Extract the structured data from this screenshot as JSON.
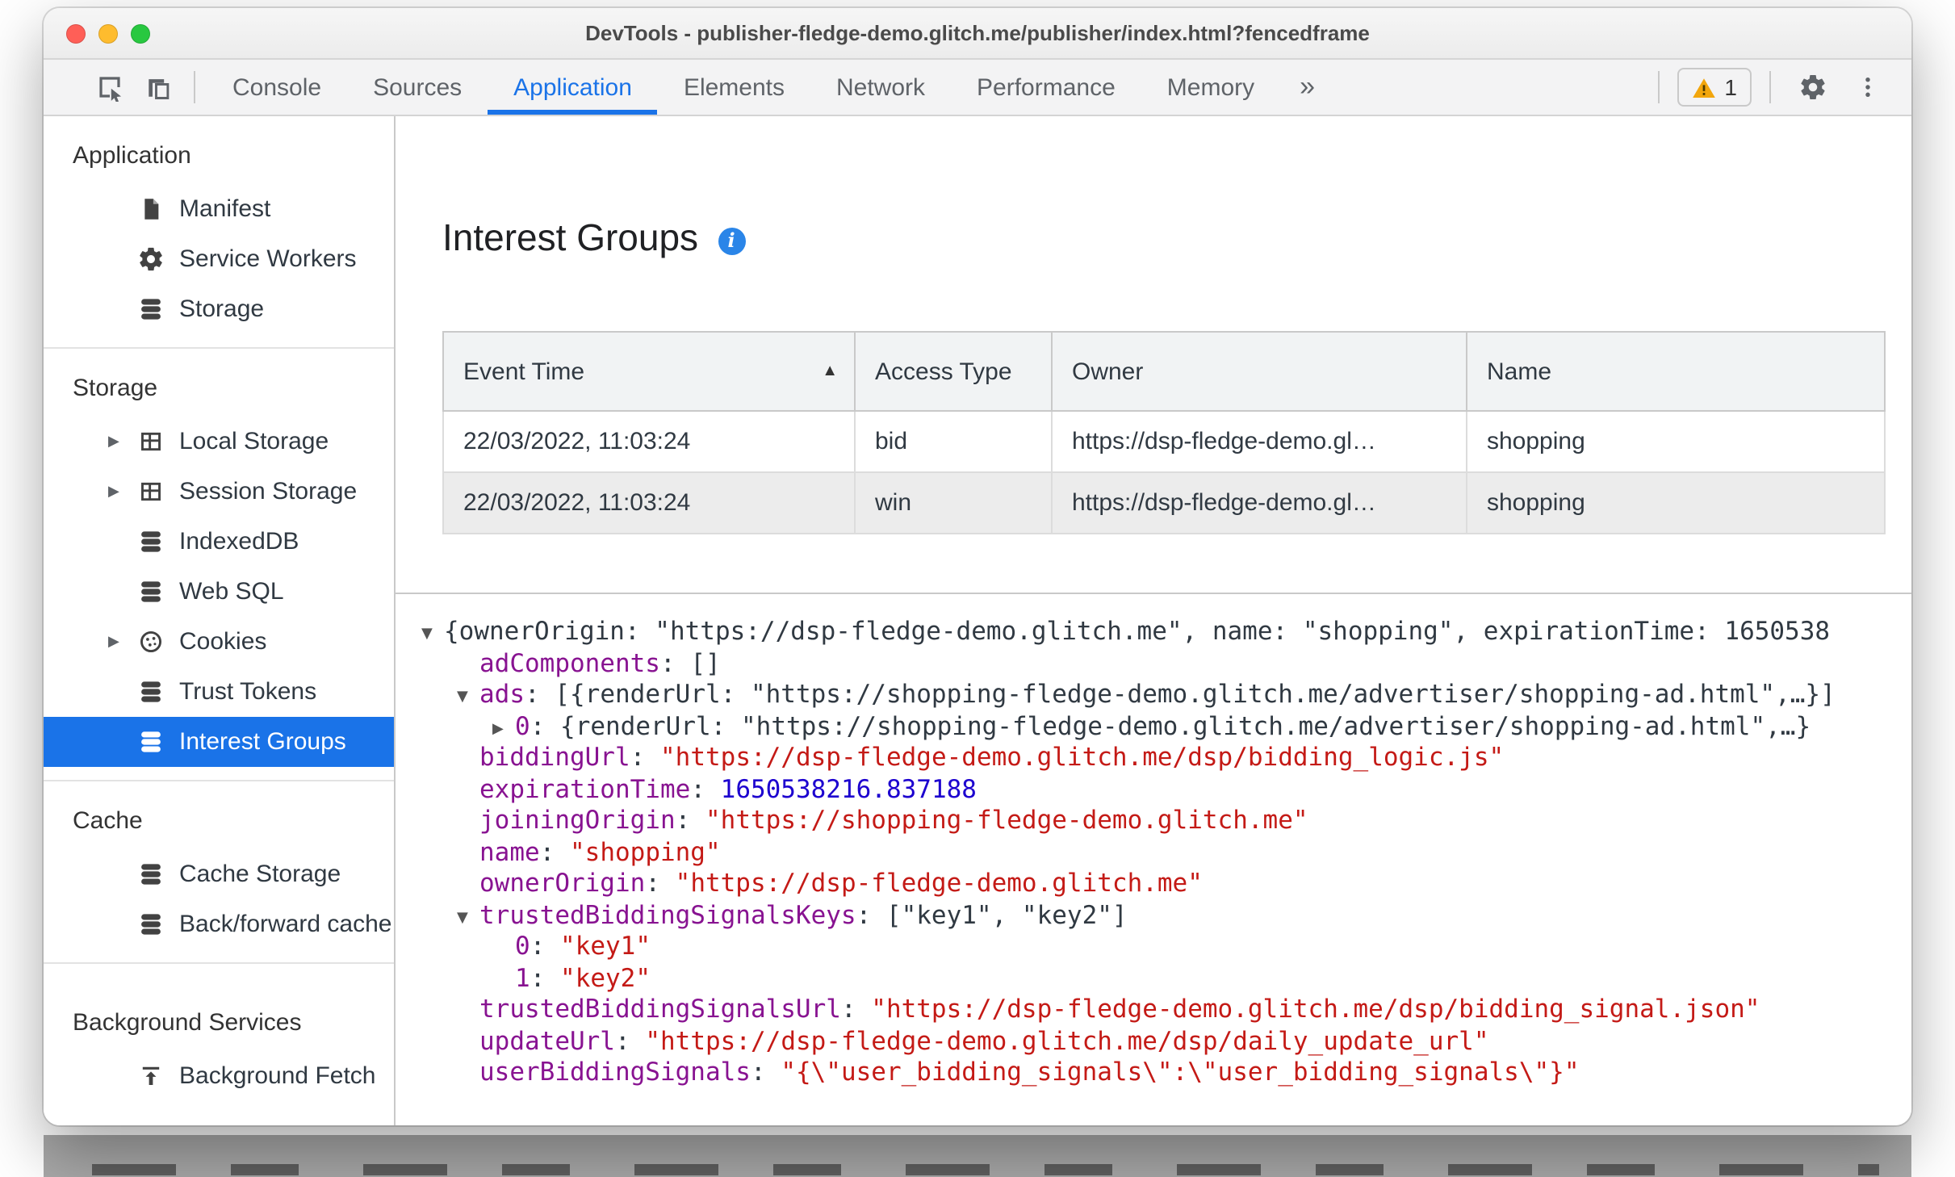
{
  "colors": {
    "accent": "#1a73e8",
    "key": "#881391",
    "string": "#c41a16",
    "number": "#1c00cf",
    "warning": "#f2a60d"
  },
  "window": {
    "title": "DevTools - publisher-fledge-demo.glitch.me/publisher/index.html?fencedframe"
  },
  "toolbar": {
    "tabs": [
      {
        "label": "Console",
        "selected": false
      },
      {
        "label": "Sources",
        "selected": false
      },
      {
        "label": "Application",
        "selected": true
      },
      {
        "label": "Elements",
        "selected": false
      },
      {
        "label": "Network",
        "selected": false
      },
      {
        "label": "Performance",
        "selected": false
      },
      {
        "label": "Memory",
        "selected": false
      }
    ],
    "more_tabs_label": "»",
    "warning_count": "1"
  },
  "sidebar": {
    "sections": [
      {
        "header": "Application",
        "items": [
          {
            "label": "Manifest",
            "icon": "document"
          },
          {
            "label": "Service Workers",
            "icon": "gear"
          },
          {
            "label": "Storage",
            "icon": "database"
          }
        ]
      },
      {
        "header": "Storage",
        "items": [
          {
            "label": "Local Storage",
            "icon": "table",
            "expandable": true
          },
          {
            "label": "Session Storage",
            "icon": "table",
            "expandable": true
          },
          {
            "label": "IndexedDB",
            "icon": "database"
          },
          {
            "label": "Web SQL",
            "icon": "database"
          },
          {
            "label": "Cookies",
            "icon": "cookie",
            "expandable": true
          },
          {
            "label": "Trust Tokens",
            "icon": "database"
          },
          {
            "label": "Interest Groups",
            "icon": "database",
            "selected": true
          }
        ]
      },
      {
        "header": "Cache",
        "items": [
          {
            "label": "Cache Storage",
            "icon": "database"
          },
          {
            "label": "Back/forward cache",
            "icon": "database"
          }
        ]
      },
      {
        "header": "Background Services",
        "items": [
          {
            "label": "Background Fetch",
            "icon": "fetch"
          }
        ]
      }
    ]
  },
  "content": {
    "title": "Interest Groups",
    "table": {
      "columns": [
        "Event Time",
        "Access Type",
        "Owner",
        "Name"
      ],
      "rows": [
        [
          "22/03/2022, 11:03:24",
          "bid",
          "https://dsp-fledge-demo.gl…",
          "shopping"
        ],
        [
          "22/03/2022, 11:03:24",
          "win",
          "https://dsp-fledge-demo.gl…",
          "shopping"
        ]
      ]
    },
    "tree": {
      "lines": [
        {
          "indent": 0,
          "arrow": "down",
          "parts": [
            {
              "t": "{ownerOrigin: \"https://dsp-fledge-demo.glitch.me\", name: \"shopping\", expirationTime: 1650538",
              "c": "plain"
            }
          ]
        },
        {
          "indent": 1,
          "arrow": null,
          "parts": [
            {
              "t": "adComponents",
              "c": "key"
            },
            {
              "t": ": ",
              "c": "plain"
            },
            {
              "t": "[]",
              "c": "plain"
            }
          ]
        },
        {
          "indent": 1,
          "arrow": "down",
          "parts": [
            {
              "t": "ads",
              "c": "key"
            },
            {
              "t": ": ",
              "c": "plain"
            },
            {
              "t": "[{renderUrl: \"https://shopping-fledge-demo.glitch.me/advertiser/shopping-ad.html\",…}]",
              "c": "plain"
            }
          ]
        },
        {
          "indent": 2,
          "arrow": "right",
          "parts": [
            {
              "t": "0",
              "c": "key"
            },
            {
              "t": ": ",
              "c": "plain"
            },
            {
              "t": "{renderUrl: \"https://shopping-fledge-demo.glitch.me/advertiser/shopping-ad.html\",…}",
              "c": "plain"
            }
          ]
        },
        {
          "indent": 1,
          "arrow": null,
          "parts": [
            {
              "t": "biddingUrl",
              "c": "key"
            },
            {
              "t": ": ",
              "c": "plain"
            },
            {
              "t": "\"https://dsp-fledge-demo.glitch.me/dsp/bidding_logic.js\"",
              "c": "str"
            }
          ]
        },
        {
          "indent": 1,
          "arrow": null,
          "parts": [
            {
              "t": "expirationTime",
              "c": "key"
            },
            {
              "t": ": ",
              "c": "plain"
            },
            {
              "t": "1650538216.837188",
              "c": "num"
            }
          ]
        },
        {
          "indent": 1,
          "arrow": null,
          "parts": [
            {
              "t": "joiningOrigin",
              "c": "key"
            },
            {
              "t": ": ",
              "c": "plain"
            },
            {
              "t": "\"https://shopping-fledge-demo.glitch.me\"",
              "c": "str"
            }
          ]
        },
        {
          "indent": 1,
          "arrow": null,
          "parts": [
            {
              "t": "name",
              "c": "key"
            },
            {
              "t": ": ",
              "c": "plain"
            },
            {
              "t": "\"shopping\"",
              "c": "str"
            }
          ]
        },
        {
          "indent": 1,
          "arrow": null,
          "parts": [
            {
              "t": "ownerOrigin",
              "c": "key"
            },
            {
              "t": ": ",
              "c": "plain"
            },
            {
              "t": "\"https://dsp-fledge-demo.glitch.me\"",
              "c": "str"
            }
          ]
        },
        {
          "indent": 1,
          "arrow": "down",
          "parts": [
            {
              "t": "trustedBiddingSignalsKeys",
              "c": "key"
            },
            {
              "t": ": ",
              "c": "plain"
            },
            {
              "t": "[\"key1\", \"key2\"]",
              "c": "plain"
            }
          ]
        },
        {
          "indent": 2,
          "arrow": null,
          "parts": [
            {
              "t": "0",
              "c": "key"
            },
            {
              "t": ": ",
              "c": "plain"
            },
            {
              "t": "\"key1\"",
              "c": "str"
            }
          ]
        },
        {
          "indent": 2,
          "arrow": null,
          "parts": [
            {
              "t": "1",
              "c": "key"
            },
            {
              "t": ": ",
              "c": "plain"
            },
            {
              "t": "\"key2\"",
              "c": "str"
            }
          ]
        },
        {
          "indent": 1,
          "arrow": null,
          "parts": [
            {
              "t": "trustedBiddingSignalsUrl",
              "c": "key"
            },
            {
              "t": ": ",
              "c": "plain"
            },
            {
              "t": "\"https://dsp-fledge-demo.glitch.me/dsp/bidding_signal.json\"",
              "c": "str"
            }
          ]
        },
        {
          "indent": 1,
          "arrow": null,
          "parts": [
            {
              "t": "updateUrl",
              "c": "key"
            },
            {
              "t": ": ",
              "c": "plain"
            },
            {
              "t": "\"https://dsp-fledge-demo.glitch.me/dsp/daily_update_url\"",
              "c": "str"
            }
          ]
        },
        {
          "indent": 1,
          "arrow": null,
          "parts": [
            {
              "t": "userBiddingSignals",
              "c": "key"
            },
            {
              "t": ": ",
              "c": "plain"
            },
            {
              "t": "\"{\\\"user_bidding_signals\\\":\\\"user_bidding_signals\\\"}\"",
              "c": "str"
            }
          ]
        }
      ]
    }
  }
}
